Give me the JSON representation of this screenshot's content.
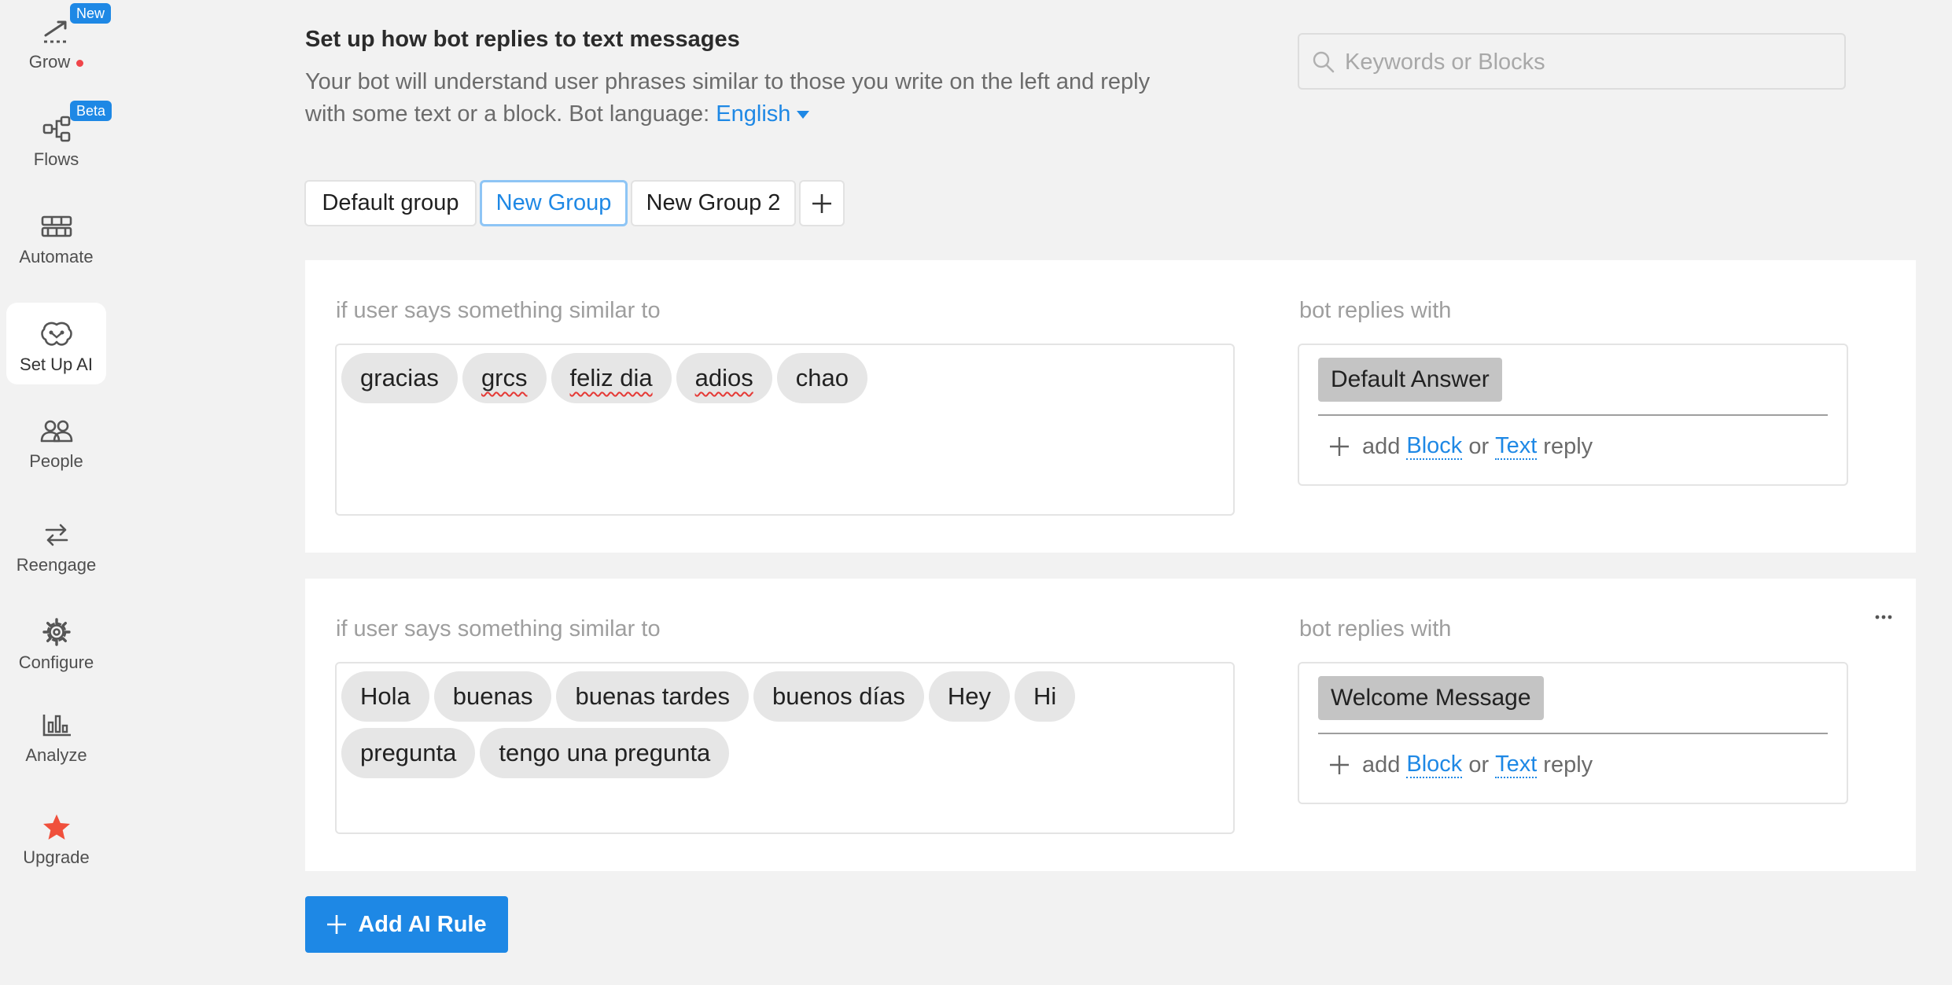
{
  "sidebar": {
    "items": [
      {
        "label": "Grow",
        "icon": "grow-icon",
        "badge": "New",
        "dot": true
      },
      {
        "label": "Flows",
        "icon": "flows-icon",
        "badge": "Beta"
      },
      {
        "label": "Automate",
        "icon": "automate-icon"
      },
      {
        "label": "Set Up AI",
        "icon": "brain-icon",
        "active": true
      },
      {
        "label": "People",
        "icon": "people-icon"
      },
      {
        "label": "Reengage",
        "icon": "reengage-icon"
      },
      {
        "label": "Configure",
        "icon": "gear-icon"
      },
      {
        "label": "Analyze",
        "icon": "bar-chart-icon"
      },
      {
        "label": "Upgrade",
        "icon": "star-icon"
      }
    ]
  },
  "header": {
    "title": "Set up how bot replies to text messages",
    "description": "Your bot will understand user phrases similar to those you write on the left and reply with some text or a block. Bot language:",
    "language": "English"
  },
  "search": {
    "placeholder": "Keywords or Blocks",
    "icon": "search-icon"
  },
  "tabs": [
    {
      "label": "Default group",
      "active": false
    },
    {
      "label": "New Group",
      "active": true
    },
    {
      "label": "New Group 2",
      "active": false
    }
  ],
  "tab_add_icon": "plus-icon",
  "rules": [
    {
      "user_label": "if user says something similar to",
      "phrases": [
        "gracias",
        "grcs",
        "feliz dia",
        "adios",
        "chao"
      ],
      "bot_label": "bot replies with",
      "reply": "Default Answer",
      "add_prefix": "add",
      "add_block": "Block",
      "add_or": "or",
      "add_text": "Text",
      "add_suffix": "reply"
    },
    {
      "user_label": "if user says something similar to",
      "phrases": [
        "Hola",
        "buenas",
        "buenas tardes",
        "buenos días",
        "Hey",
        "Hi",
        "pregunta",
        "tengo una pregunta"
      ],
      "bot_label": "bot replies with",
      "reply": "Welcome Message",
      "add_prefix": "add",
      "add_block": "Block",
      "add_or": "or",
      "add_text": "Text",
      "add_suffix": "reply",
      "more_icon": "more-horizontal-icon"
    }
  ],
  "add_rule_button": "Add AI Rule",
  "colors": {
    "accent": "#1e88e5",
    "background": "#f2f2f2",
    "chip": "#e6e6e6",
    "reply_chip": "#c4c4c4",
    "upgrade_star": "#f0503c",
    "notification_dot": "#f0454a"
  }
}
